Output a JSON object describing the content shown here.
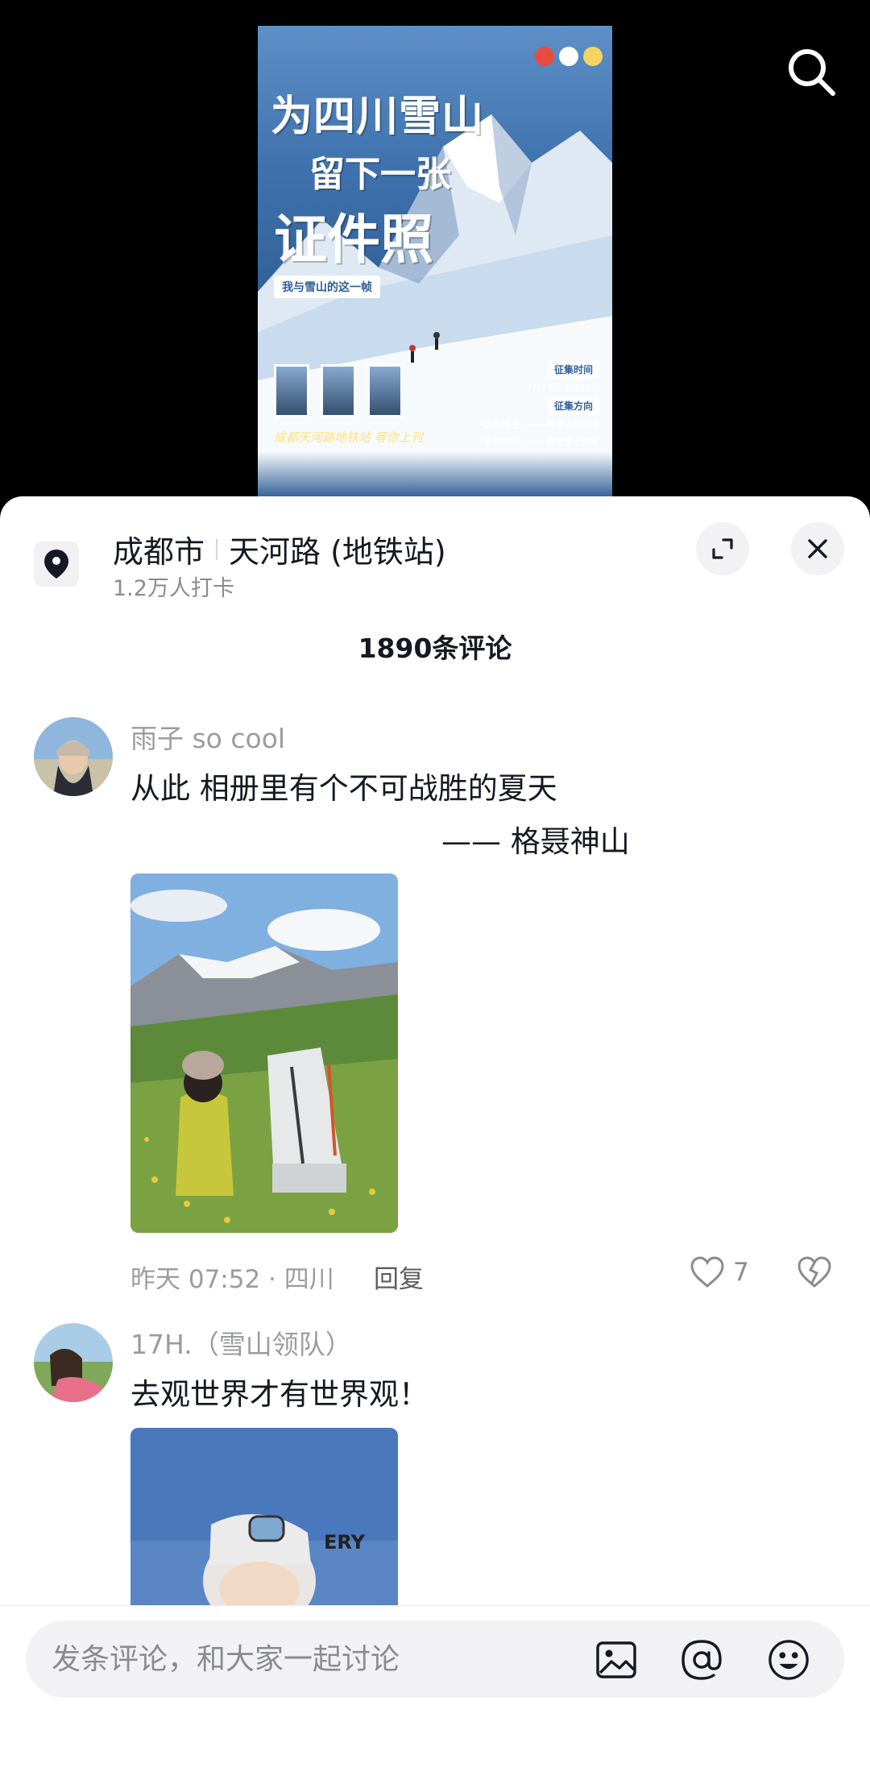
{
  "poster": {
    "title_line1": "为四川雪山",
    "title_line2": "留下一张",
    "title_line3": "证件照",
    "tag": "我与雪山的这一帧",
    "info_label1": "征集时间",
    "info_date": "7月24日-7月31日",
    "info_label2": "征集方向",
    "info_dir1": "「山的样子」——纯雪山风景照",
    "info_dir2": "「你和雪山」——你与雪山合照",
    "sign": "成都天河路地铁站  等你上刊"
  },
  "location": {
    "city": "成都市",
    "place": "天河路 (地铁站)",
    "checkins": "1.2万人打卡"
  },
  "comments_header": {
    "count": "1890条评论"
  },
  "comments": [
    {
      "user": "雨子 so cool",
      "text": "从此 相册里有个不可战胜的夏天",
      "signature": "—— 格聂神山",
      "meta": "昨天 07:52 · 四川",
      "reply": "回复",
      "likes": "7"
    },
    {
      "user": "17H.（雪山领队）",
      "text": "去观世界才有世界观！"
    }
  ],
  "input": {
    "placeholder": "发条评论，和大家一起讨论"
  },
  "icons": {
    "search": "search-icon",
    "location": "location-pin-icon",
    "expand": "expand-icon",
    "close": "close-icon",
    "like": "heart-icon",
    "dislike": "broken-heart-icon",
    "image": "image-icon",
    "mention": "at-icon",
    "emoji": "emoji-icon"
  }
}
